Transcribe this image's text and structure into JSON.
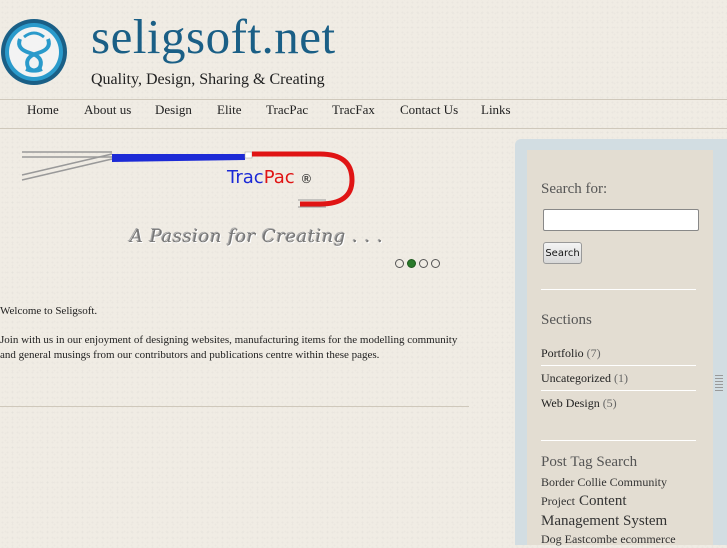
{
  "header": {
    "site_title": "seligsoft.net",
    "tagline": "Quality, Design, Sharing & Creating",
    "logo_icon": "ss-circle-logo",
    "brand_color": "#1a5f86"
  },
  "nav": {
    "items": [
      {
        "label": "Home"
      },
      {
        "label": "About us"
      },
      {
        "label": "Design"
      },
      {
        "label": "Elite"
      },
      {
        "label": "TracPac"
      },
      {
        "label": "TracFax"
      },
      {
        "label": "Contact Us"
      },
      {
        "label": "Links"
      }
    ]
  },
  "slider": {
    "brand_part1": "Trac",
    "brand_part2": "Pac",
    "registered": "®",
    "slogan": "A Passion for Creating . . .",
    "slide_count": 4,
    "active_slide": 2
  },
  "content": {
    "welcome": "Welcome to Seligsoft.",
    "body": "Join with us in our enjoyment of designing websites, manufacturing items for the modelling community and general musings from our contributors and publications centre within these pages."
  },
  "sidebar": {
    "search_heading": "Search for:",
    "search_value": "",
    "search_button": "Search",
    "sections_heading": "Sections",
    "sections": [
      {
        "label": "Portfolio",
        "count": "(7)"
      },
      {
        "label": "Uncategorized",
        "count": "(1)"
      },
      {
        "label": "Web Design",
        "count": "(5)"
      }
    ],
    "tags_heading": "Post Tag Search",
    "tags": [
      {
        "label": "Border Collie",
        "size": "s"
      },
      {
        "label": "Community",
        "size": "s"
      },
      {
        "label": "Project",
        "size": "s"
      },
      {
        "label": "Content",
        "size": "l"
      },
      {
        "label": "Management System",
        "size": "l"
      },
      {
        "label": "Dog",
        "size": "s"
      },
      {
        "label": "Eastcombe",
        "size": "s"
      },
      {
        "label": "ecommerce",
        "size": "s"
      }
    ]
  }
}
